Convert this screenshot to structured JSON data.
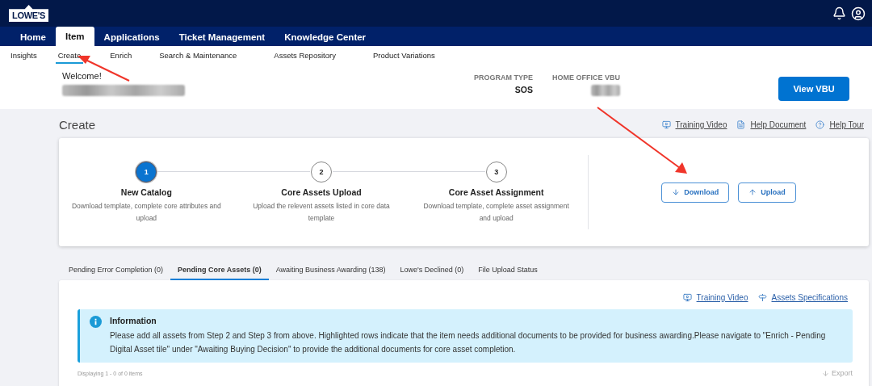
{
  "header": {
    "logo": "LOWE'S"
  },
  "nav_tabs": [
    {
      "label": "Home",
      "selected": false
    },
    {
      "label": "Item",
      "selected": true
    },
    {
      "label": "Applications",
      "selected": false
    },
    {
      "label": "Ticket Management",
      "selected": false
    },
    {
      "label": "Knowledge Center",
      "selected": false
    }
  ],
  "sub_nav": [
    {
      "label": "Insights",
      "selected": false
    },
    {
      "label": "Create",
      "selected": true
    },
    {
      "label": "Enrich",
      "selected": false
    },
    {
      "label": "Search & Maintenance",
      "selected": false
    },
    {
      "label": "Assets Repository",
      "selected": false
    },
    {
      "label": "Product Variations",
      "selected": false
    }
  ],
  "welcome": {
    "greeting": "Welcome!"
  },
  "program_info": [
    {
      "label": "PROGRAM TYPE",
      "value": "SOS"
    },
    {
      "label": "HOME OFFICE VBU"
    }
  ],
  "view_button": "View VBU",
  "page_title": "Create",
  "help_links": [
    {
      "kind": "video",
      "label": "Training Video"
    },
    {
      "kind": "document",
      "label": "Help Document"
    },
    {
      "kind": "tour",
      "label": "Help Tour"
    }
  ],
  "steps": [
    {
      "number": "1",
      "title": "New Catalog",
      "description": "Download template, complete core attributes and upload",
      "selected": true
    },
    {
      "number": "2",
      "title": "Core Assets Upload",
      "description": "Upload the relevent assets listed in core data template",
      "selected": false
    },
    {
      "number": "3",
      "title": "Core Asset Assignment",
      "description": "Download template, complete asset assignment and upload",
      "selected": false
    }
  ],
  "actions": [
    {
      "kind": "download",
      "label": "Download"
    },
    {
      "kind": "upload",
      "label": "Upload"
    }
  ],
  "result_tabs": [
    {
      "label": "Pending Error Completion (0)",
      "selected": false
    },
    {
      "label": "Pending Core Assets (0)",
      "selected": true
    },
    {
      "label": "Awaiting Business Awarding (138)",
      "selected": false
    },
    {
      "label": "Lowe's Declined (0)",
      "selected": false
    },
    {
      "label": "File Upload Status",
      "selected": false
    }
  ],
  "panel_links": [
    {
      "kind": "video",
      "label": "Training Video"
    },
    {
      "kind": "specs",
      "label": "Assets Specifications"
    }
  ],
  "info": {
    "title": "Information",
    "text": "Please add all assets from Step 2 and Step 3 from above. Highlighted rows indicate that the item needs additional documents to be provided for business awarding.Please navigate to \"Enrich - Pending Digital Asset tile\" under \"Awaiting Buying Decision\" to provide the additional documents for core asset completion."
  },
  "table_footer": {
    "summary": "Displaying 1 - 0 of 0 items",
    "export": "Export"
  }
}
